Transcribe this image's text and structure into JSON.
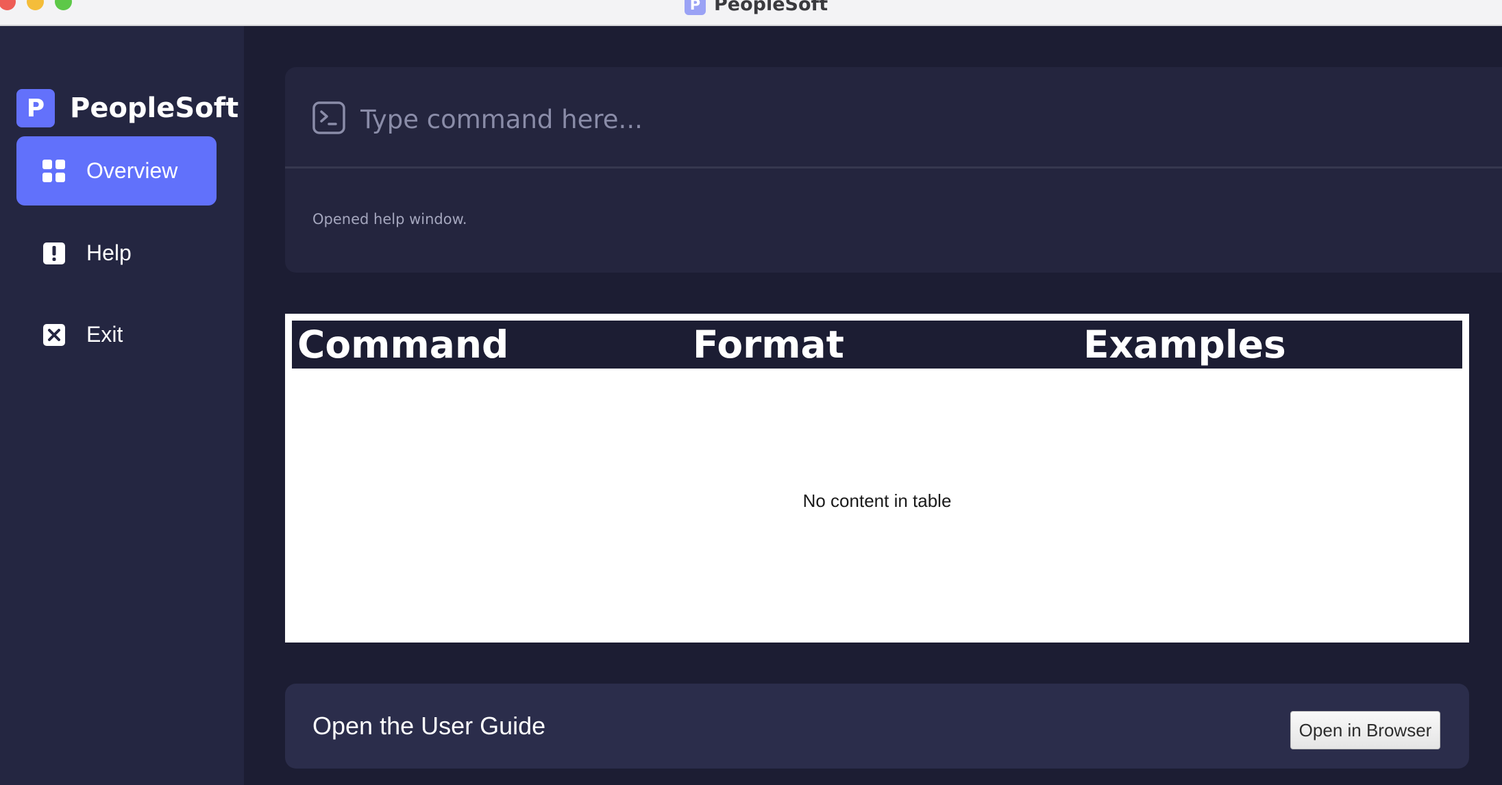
{
  "window": {
    "title": "PeopleSoft",
    "title_icon_letter": "P"
  },
  "sidebar": {
    "brand": {
      "logo_letter": "P",
      "name": "PeopleSoft"
    },
    "items": [
      {
        "label": "Overview",
        "icon": "grid-icon",
        "active": true
      },
      {
        "label": "Help",
        "icon": "exclamation-icon",
        "active": false
      },
      {
        "label": "Exit",
        "icon": "close-box-icon",
        "active": false
      }
    ]
  },
  "command": {
    "icon": "terminal-icon",
    "placeholder": "Type command here...",
    "result": "Opened help window."
  },
  "help_table": {
    "columns": [
      "Command",
      "Format",
      "Examples"
    ],
    "empty_message": "No content in table"
  },
  "user_guide": {
    "label": "Open the User Guide",
    "button_label": "Open in Browser"
  },
  "colors": {
    "accent": "#6171fb",
    "background": "#1c1d33",
    "sidebar": "#242641",
    "panel": "#24253e"
  }
}
